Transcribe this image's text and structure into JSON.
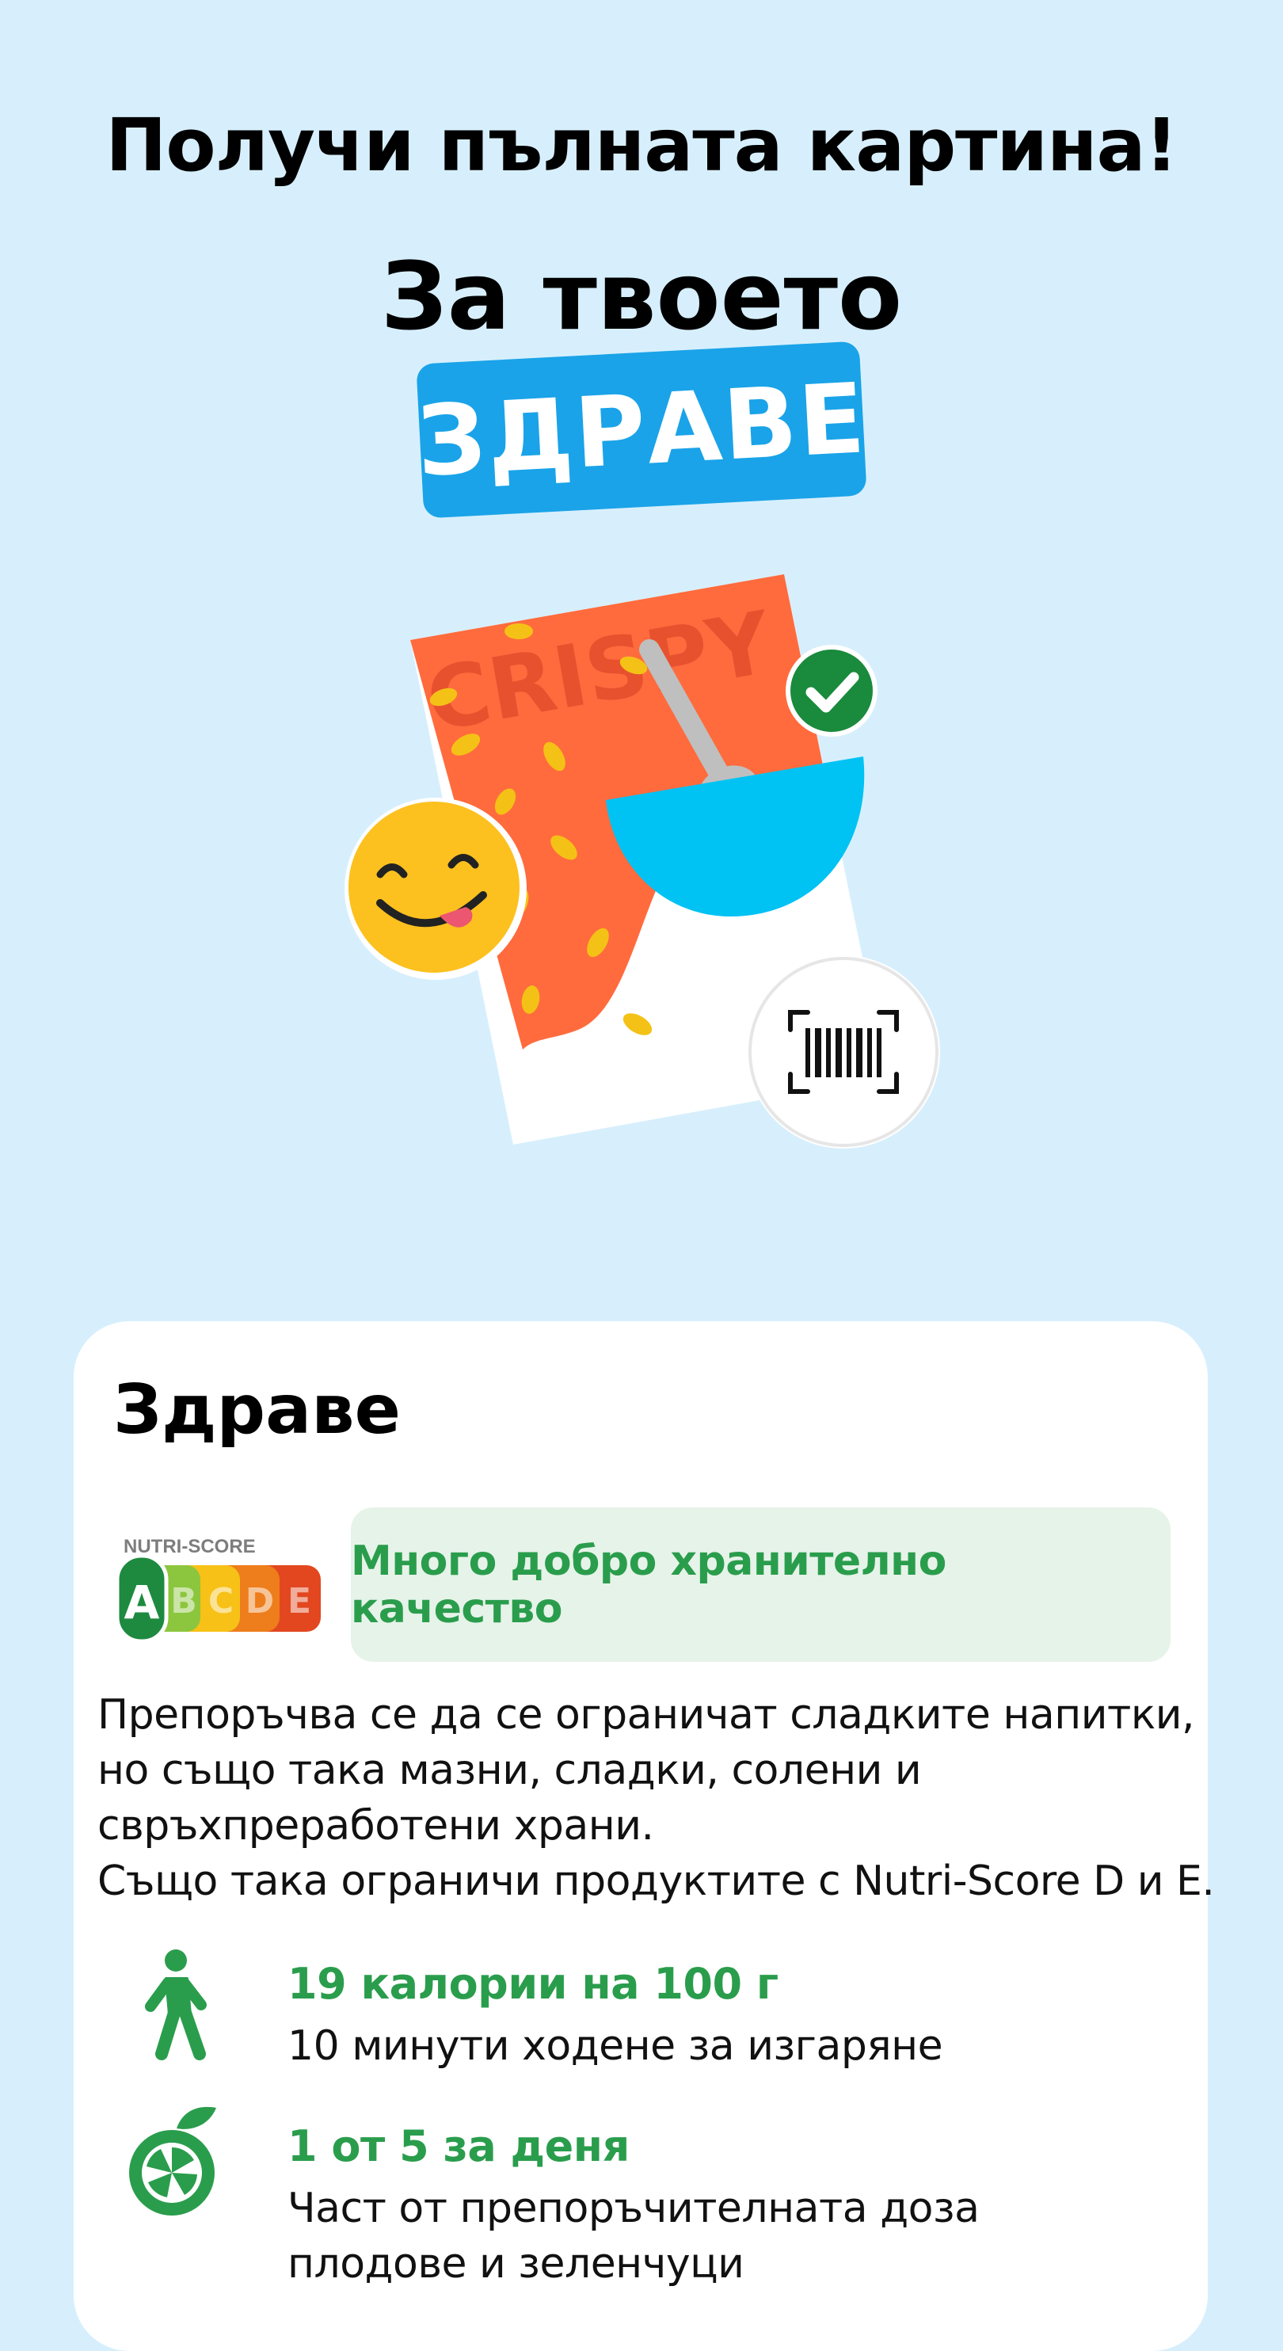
{
  "hero": {
    "headline": "Получи пълната картина!",
    "subheading": "За твоето",
    "highlight": "ЗДРАВЕ"
  },
  "illustration": {
    "package_text": "CRISPY",
    "icons": [
      "emoji-face-icon",
      "check-badge-icon",
      "barcode-icon",
      "cereal-box-icon"
    ]
  },
  "health_card": {
    "title": "Здраве",
    "nutri_score": {
      "label": "NUTRI-SCORE",
      "grades": [
        "A",
        "B",
        "C",
        "D",
        "E"
      ],
      "selected": "A",
      "colors": [
        "#1e8a3f",
        "#8cc63e",
        "#f7c117",
        "#ee7d1b",
        "#e2471f"
      ]
    },
    "quality_text": "Много добро хранително качество",
    "recommendation_lines": [
      "Препоръчва се да се ограничат сладките напитки,",
      "но също така мазни, сладки, солени и",
      "свръхпреработени храни.",
      "Също така ограничи продуктите с Nutri-Score D и E."
    ],
    "items": [
      {
        "icon": "walking-person-icon",
        "title": "19 калории на 100 г",
        "lines": [
          "10 минути ходене за изгаряне"
        ]
      },
      {
        "icon": "fruit-icon",
        "title": "1 от 5 за деня",
        "lines": [
          "Част от препоръчителната доза",
          "плодове и зеленчуци"
        ]
      }
    ]
  },
  "colors": {
    "background": "#d7effc",
    "accent_blue": "#1aa3e8",
    "green": "#2a9d4c"
  }
}
